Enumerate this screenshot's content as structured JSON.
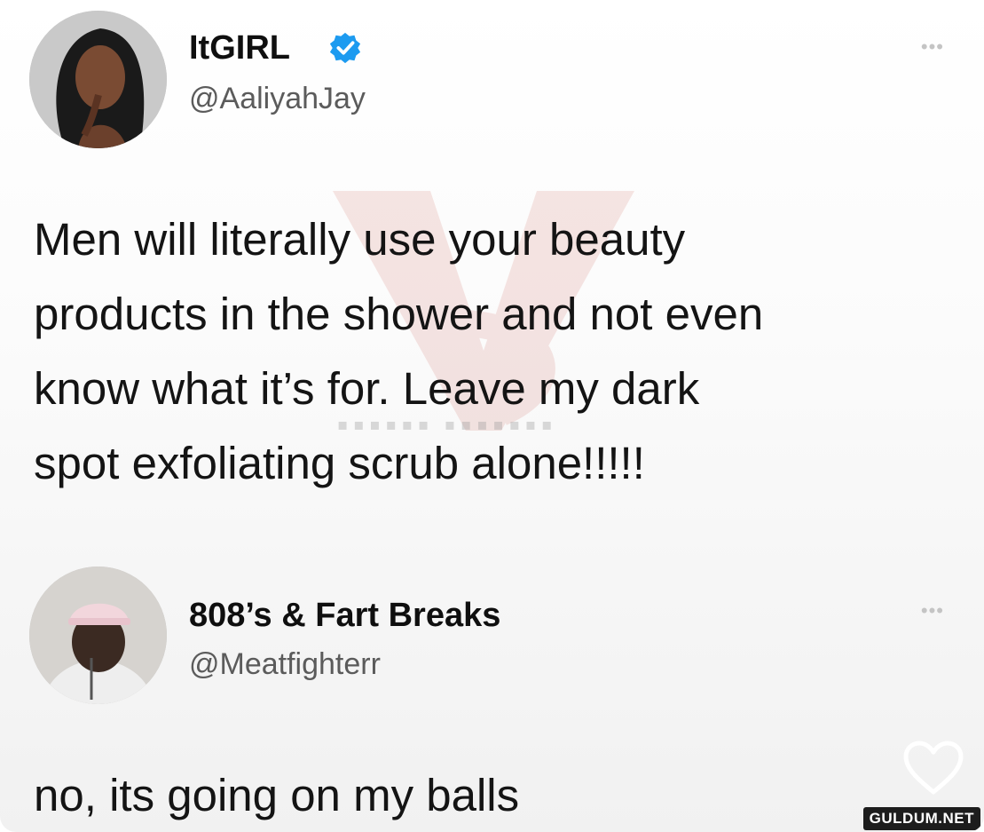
{
  "tweet": {
    "display_name": "ItGIRL",
    "handle": "@AaliyahJay",
    "verified": true,
    "text_lines": [
      "Men will literally use your beauty",
      "products in the shower and not even",
      "know what it’s for. Leave my dark",
      "spot exfoliating scrub alone!!!!!"
    ]
  },
  "reply": {
    "display_name": "808’s & Fart Breaks",
    "handle": "@Meatfighterr",
    "text": "no, its going on my balls"
  },
  "icons": {
    "more": "more-icon",
    "verified": "verified-badge-icon",
    "like": "heart-icon"
  },
  "watermark_site": "GULDUM.NET",
  "colors": {
    "verified_blue": "#1d9bf0",
    "text": "#141414",
    "handle": "#5b5b5b",
    "watermark": "#c0392b"
  }
}
